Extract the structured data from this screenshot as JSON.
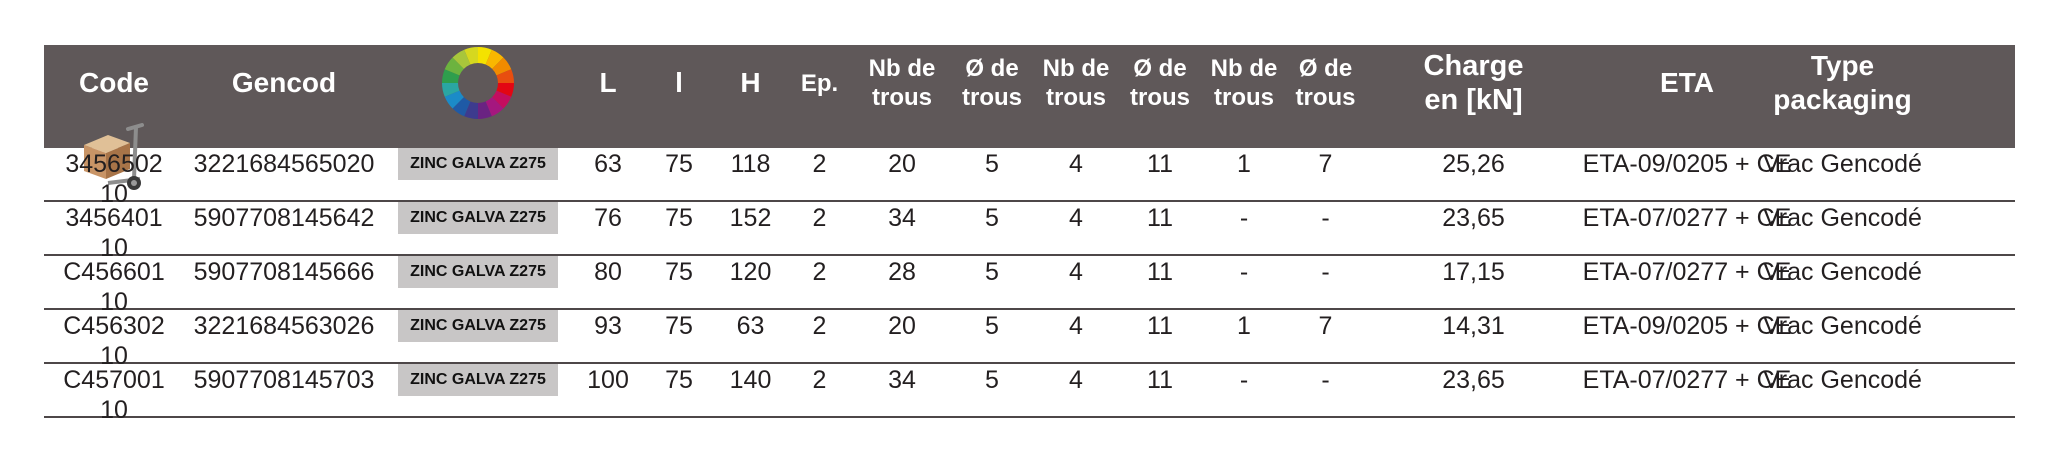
{
  "headers": {
    "code": "Code",
    "gencod": "Gencod",
    "finish_icon": "color-wheel-icon",
    "L": "L",
    "l": "l",
    "H": "H",
    "ep": "Ep.",
    "nb_trous_1": [
      "Nb de",
      "trous"
    ],
    "diam_trous_1": [
      "Ø de",
      "trous"
    ],
    "nb_trous_2": [
      "Nb de",
      "trous"
    ],
    "diam_trous_2": [
      "Ø de",
      "trous"
    ],
    "nb_trous_3": [
      "Nb de",
      "trous"
    ],
    "diam_trous_3": [
      "Ø de",
      "trous"
    ],
    "charge": [
      "Charge",
      "en [kN]"
    ],
    "eta": "ETA",
    "type_packaging": [
      "Type",
      "packaging"
    ],
    "qty_icon": "hand-truck-box-icon"
  },
  "rows": [
    {
      "code": "3456502",
      "gencod": "3221684565020",
      "finish": "ZINC GALVA Z275",
      "L": "63",
      "l": "75",
      "H": "118",
      "ep": "2",
      "nb1": "20",
      "d1": "5",
      "nb2": "4",
      "d2": "11",
      "nb3": "1",
      "d3": "7",
      "charge": "25,26",
      "eta": "ETA-09/0205 + CE",
      "packaging": "Vrac Gencodé",
      "qty": "10"
    },
    {
      "code": "3456401",
      "gencod": "5907708145642",
      "finish": "ZINC GALVA Z275",
      "L": "76",
      "l": "75",
      "H": "152",
      "ep": "2",
      "nb1": "34",
      "d1": "5",
      "nb2": "4",
      "d2": "11",
      "nb3": "-",
      "d3": "-",
      "charge": "23,65",
      "eta": "ETA-07/0277 + CE",
      "packaging": "Vrac Gencodé",
      "qty": "10"
    },
    {
      "code": "C456601",
      "gencod": "5907708145666",
      "finish": "ZINC GALVA Z275",
      "L": "80",
      "l": "75",
      "H": "120",
      "ep": "2",
      "nb1": "28",
      "d1": "5",
      "nb2": "4",
      "d2": "11",
      "nb3": "-",
      "d3": "-",
      "charge": "17,15",
      "eta": "ETA-07/0277 + CE",
      "packaging": "Vrac Gencodé",
      "qty": "10"
    },
    {
      "code": "C456302",
      "gencod": "3221684563026",
      "finish": "ZINC GALVA Z275",
      "L": "93",
      "l": "75",
      "H": "63",
      "ep": "2",
      "nb1": "20",
      "d1": "5",
      "nb2": "4",
      "d2": "11",
      "nb3": "1",
      "d3": "7",
      "charge": "14,31",
      "eta": "ETA-09/0205 + CE",
      "packaging": "Vrac Gencodé",
      "qty": "10"
    },
    {
      "code": "C457001",
      "gencod": "5907708145703",
      "finish": "ZINC GALVA Z275",
      "L": "100",
      "l": "75",
      "H": "140",
      "ep": "2",
      "nb1": "34",
      "d1": "5",
      "nb2": "4",
      "d2": "11",
      "nb3": "-",
      "d3": "-",
      "charge": "23,65",
      "eta": "ETA-07/0277 + CE",
      "packaging": "Vrac Gencodé",
      "qty": "10"
    }
  ],
  "colors": {
    "header_bg": "#5f5859",
    "header_text": "#ffffff",
    "finish_badge_bg": "#c8c6c6",
    "row_border": "#4d4748"
  }
}
